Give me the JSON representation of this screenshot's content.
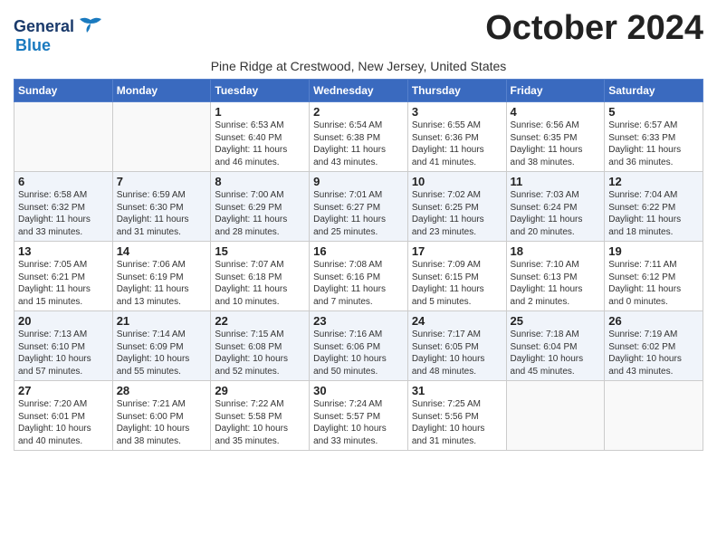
{
  "logo": {
    "line1": "General",
    "line2": "Blue"
  },
  "title": "October 2024",
  "subtitle": "Pine Ridge at Crestwood, New Jersey, United States",
  "days_header": [
    "Sunday",
    "Monday",
    "Tuesday",
    "Wednesday",
    "Thursday",
    "Friday",
    "Saturday"
  ],
  "weeks": [
    [
      {
        "day": "",
        "info": ""
      },
      {
        "day": "",
        "info": ""
      },
      {
        "day": "1",
        "info": "Sunrise: 6:53 AM\nSunset: 6:40 PM\nDaylight: 11 hours\nand 46 minutes."
      },
      {
        "day": "2",
        "info": "Sunrise: 6:54 AM\nSunset: 6:38 PM\nDaylight: 11 hours\nand 43 minutes."
      },
      {
        "day": "3",
        "info": "Sunrise: 6:55 AM\nSunset: 6:36 PM\nDaylight: 11 hours\nand 41 minutes."
      },
      {
        "day": "4",
        "info": "Sunrise: 6:56 AM\nSunset: 6:35 PM\nDaylight: 11 hours\nand 38 minutes."
      },
      {
        "day": "5",
        "info": "Sunrise: 6:57 AM\nSunset: 6:33 PM\nDaylight: 11 hours\nand 36 minutes."
      }
    ],
    [
      {
        "day": "6",
        "info": "Sunrise: 6:58 AM\nSunset: 6:32 PM\nDaylight: 11 hours\nand 33 minutes."
      },
      {
        "day": "7",
        "info": "Sunrise: 6:59 AM\nSunset: 6:30 PM\nDaylight: 11 hours\nand 31 minutes."
      },
      {
        "day": "8",
        "info": "Sunrise: 7:00 AM\nSunset: 6:29 PM\nDaylight: 11 hours\nand 28 minutes."
      },
      {
        "day": "9",
        "info": "Sunrise: 7:01 AM\nSunset: 6:27 PM\nDaylight: 11 hours\nand 25 minutes."
      },
      {
        "day": "10",
        "info": "Sunrise: 7:02 AM\nSunset: 6:25 PM\nDaylight: 11 hours\nand 23 minutes."
      },
      {
        "day": "11",
        "info": "Sunrise: 7:03 AM\nSunset: 6:24 PM\nDaylight: 11 hours\nand 20 minutes."
      },
      {
        "day": "12",
        "info": "Sunrise: 7:04 AM\nSunset: 6:22 PM\nDaylight: 11 hours\nand 18 minutes."
      }
    ],
    [
      {
        "day": "13",
        "info": "Sunrise: 7:05 AM\nSunset: 6:21 PM\nDaylight: 11 hours\nand 15 minutes."
      },
      {
        "day": "14",
        "info": "Sunrise: 7:06 AM\nSunset: 6:19 PM\nDaylight: 11 hours\nand 13 minutes."
      },
      {
        "day": "15",
        "info": "Sunrise: 7:07 AM\nSunset: 6:18 PM\nDaylight: 11 hours\nand 10 minutes."
      },
      {
        "day": "16",
        "info": "Sunrise: 7:08 AM\nSunset: 6:16 PM\nDaylight: 11 hours\nand 7 minutes."
      },
      {
        "day": "17",
        "info": "Sunrise: 7:09 AM\nSunset: 6:15 PM\nDaylight: 11 hours\nand 5 minutes."
      },
      {
        "day": "18",
        "info": "Sunrise: 7:10 AM\nSunset: 6:13 PM\nDaylight: 11 hours\nand 2 minutes."
      },
      {
        "day": "19",
        "info": "Sunrise: 7:11 AM\nSunset: 6:12 PM\nDaylight: 11 hours\nand 0 minutes."
      }
    ],
    [
      {
        "day": "20",
        "info": "Sunrise: 7:13 AM\nSunset: 6:10 PM\nDaylight: 10 hours\nand 57 minutes."
      },
      {
        "day": "21",
        "info": "Sunrise: 7:14 AM\nSunset: 6:09 PM\nDaylight: 10 hours\nand 55 minutes."
      },
      {
        "day": "22",
        "info": "Sunrise: 7:15 AM\nSunset: 6:08 PM\nDaylight: 10 hours\nand 52 minutes."
      },
      {
        "day": "23",
        "info": "Sunrise: 7:16 AM\nSunset: 6:06 PM\nDaylight: 10 hours\nand 50 minutes."
      },
      {
        "day": "24",
        "info": "Sunrise: 7:17 AM\nSunset: 6:05 PM\nDaylight: 10 hours\nand 48 minutes."
      },
      {
        "day": "25",
        "info": "Sunrise: 7:18 AM\nSunset: 6:04 PM\nDaylight: 10 hours\nand 45 minutes."
      },
      {
        "day": "26",
        "info": "Sunrise: 7:19 AM\nSunset: 6:02 PM\nDaylight: 10 hours\nand 43 minutes."
      }
    ],
    [
      {
        "day": "27",
        "info": "Sunrise: 7:20 AM\nSunset: 6:01 PM\nDaylight: 10 hours\nand 40 minutes."
      },
      {
        "day": "28",
        "info": "Sunrise: 7:21 AM\nSunset: 6:00 PM\nDaylight: 10 hours\nand 38 minutes."
      },
      {
        "day": "29",
        "info": "Sunrise: 7:22 AM\nSunset: 5:58 PM\nDaylight: 10 hours\nand 35 minutes."
      },
      {
        "day": "30",
        "info": "Sunrise: 7:24 AM\nSunset: 5:57 PM\nDaylight: 10 hours\nand 33 minutes."
      },
      {
        "day": "31",
        "info": "Sunrise: 7:25 AM\nSunset: 5:56 PM\nDaylight: 10 hours\nand 31 minutes."
      },
      {
        "day": "",
        "info": ""
      },
      {
        "day": "",
        "info": ""
      }
    ]
  ]
}
